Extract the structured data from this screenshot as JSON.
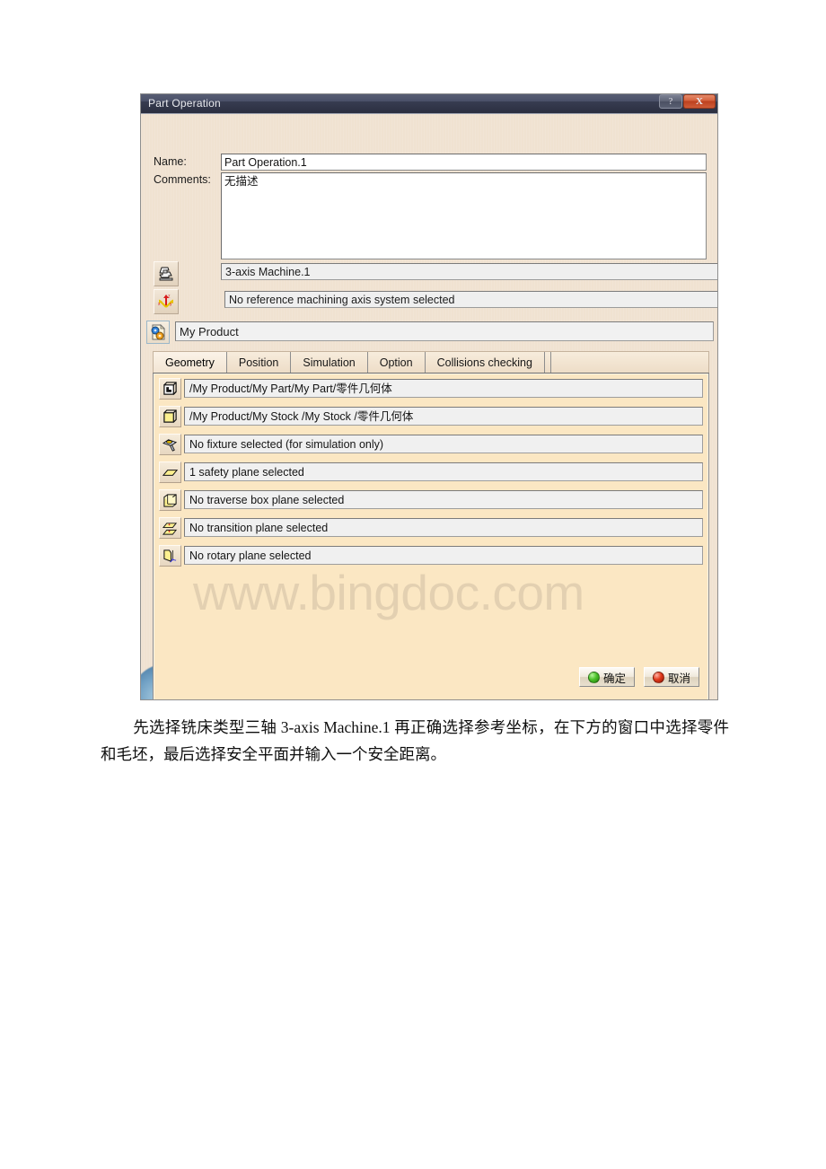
{
  "dialog": {
    "title": "Part Operation",
    "window_buttons": [
      {
        "name": "help-button",
        "label": "?"
      },
      {
        "name": "close-button",
        "label": "X"
      }
    ],
    "labels": {
      "name": "Name:",
      "comments": "Comments:"
    },
    "fields": {
      "name_value": "Part Operation.1",
      "comments_value": "无描述",
      "machine_value": "3-axis Machine.1",
      "axis_value": "No reference machining axis system selected",
      "product_value": "My Product"
    },
    "tabs": [
      {
        "label": "Geometry",
        "active": true
      },
      {
        "label": "Position",
        "active": false
      },
      {
        "label": "Simulation",
        "active": false
      },
      {
        "label": "Option",
        "active": false
      },
      {
        "label": "Collisions checking",
        "active": false
      }
    ],
    "geometry_rows": [
      {
        "icon": "part-geometry-icon",
        "value": "/My Product/My Part/My Part/零件几何体"
      },
      {
        "icon": "stock-geometry-icon",
        "value": "/My Product/My Stock /My Stock /零件几何体"
      },
      {
        "icon": "fixture-icon",
        "value": "No fixture selected (for simulation only)"
      },
      {
        "icon": "safety-plane-icon",
        "value": "1 safety plane selected"
      },
      {
        "icon": "traverse-box-plane-icon",
        "value": "No traverse box plane selected"
      },
      {
        "icon": "transition-plane-icon",
        "value": "No transition plane selected"
      },
      {
        "icon": "rotary-plane-icon",
        "value": "No rotary plane selected"
      }
    ],
    "watermark": "www.bingdoc.com",
    "footer": {
      "ok_label": "确定",
      "cancel_label": "取消"
    },
    "colors": {
      "titlebar": "#373c51",
      "dialog_face": "#f0e2d1",
      "panel_face": "#fbe7c3",
      "close_button": "#bc3f1d",
      "ok_dot": "#4cc22a",
      "cancel_dot": "#e23a1c"
    }
  },
  "caption": {
    "text": "先选择铣床类型三轴 3-axis Machine.1 再正确选择参考坐标，在下方的窗口中选择零件和毛坯，最后选择安全平面并输入一个安全距离。"
  }
}
